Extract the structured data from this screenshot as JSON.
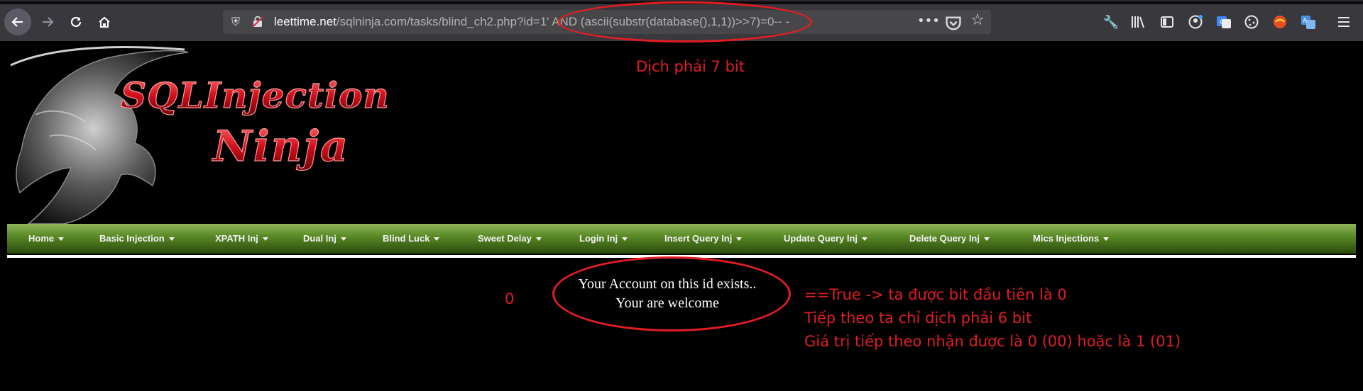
{
  "browser": {
    "url_host": "leettime.net",
    "url_path": "/sqlninja.com/tasks/blind_ch2.php?id=1' AND (ascii(substr(database(),1,1))>>7)=0-- -"
  },
  "banner": {
    "line1": "SQLInjection",
    "line2": "Ninja"
  },
  "annotations": {
    "top": "Dịch phải 7 bit",
    "right": [
      "==True -> ta được bit đầu tiên là 0",
      "Tiếp theo ta chỉ dịch phải 6 bit",
      "Giá trị tiếp theo nhận được là 0 (00) hoặc là 1 (01)"
    ]
  },
  "menu": [
    "Home",
    "Basic Injection",
    "XPATH Inj",
    "Dual Inj",
    "Blind Luck",
    "Sweet Delay",
    "Login Inj",
    "Insert Query Inj",
    "Update Query Inj",
    "Delete Query Inj",
    "Mics Injections"
  ],
  "result": {
    "number": "0",
    "line1": "Your Account on this id exists..",
    "line2": "Your are welcome"
  },
  "colors": {
    "annotation": "#e21d23",
    "menu_green": "#5a8a26",
    "page_bg": "#000000"
  }
}
